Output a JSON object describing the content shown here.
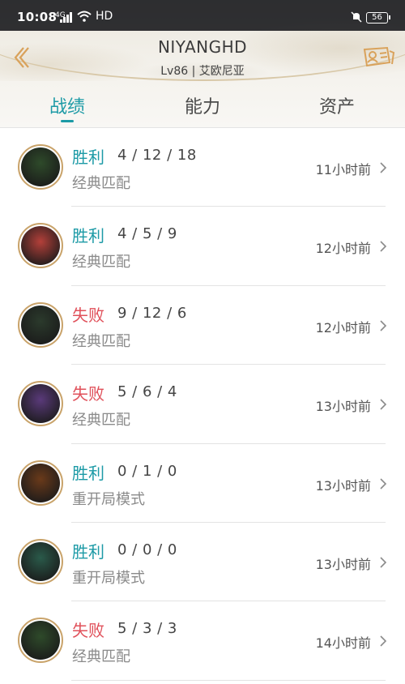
{
  "status_bar": {
    "time": "10:08",
    "network": "4G",
    "hd": "HD",
    "battery": "56"
  },
  "header": {
    "player_name": "NIYANGHD",
    "level_server": "Lv86 | 艾欧尼亚"
  },
  "tabs": [
    {
      "label": "战绩",
      "active": true
    },
    {
      "label": "能力",
      "active": false
    },
    {
      "label": "资产",
      "active": false
    }
  ],
  "colors": {
    "accent": "#1c9aa6",
    "win": "#1c9aa6",
    "loss": "#e0505a"
  },
  "matches": [
    {
      "result": "胜利",
      "outcome": "win",
      "kda": "4 / 12 / 18",
      "mode": "经典匹配",
      "time": "11小时前",
      "avatar_color": "#2e4a2a"
    },
    {
      "result": "胜利",
      "outcome": "win",
      "kda": "4 / 5 / 9",
      "mode": "经典匹配",
      "time": "12小时前",
      "avatar_color": "#b4403a"
    },
    {
      "result": "失败",
      "outcome": "loss",
      "kda": "9 / 12 / 6",
      "mode": "经典匹配",
      "time": "12小时前",
      "avatar_color": "#2b3a2c"
    },
    {
      "result": "失败",
      "outcome": "loss",
      "kda": "5 / 6 / 4",
      "mode": "经典匹配",
      "time": "13小时前",
      "avatar_color": "#5a3a7a"
    },
    {
      "result": "胜利",
      "outcome": "win",
      "kda": "0 / 1 / 0",
      "mode": "重开局模式",
      "time": "13小时前",
      "avatar_color": "#6a3a1a"
    },
    {
      "result": "胜利",
      "outcome": "win",
      "kda": "0 / 0 / 0",
      "mode": "重开局模式",
      "time": "13小时前",
      "avatar_color": "#2a5a4a"
    },
    {
      "result": "失败",
      "outcome": "loss",
      "kda": "5 / 3 / 3",
      "mode": "经典匹配",
      "time": "14小时前",
      "avatar_color": "#2e4a2a"
    }
  ]
}
